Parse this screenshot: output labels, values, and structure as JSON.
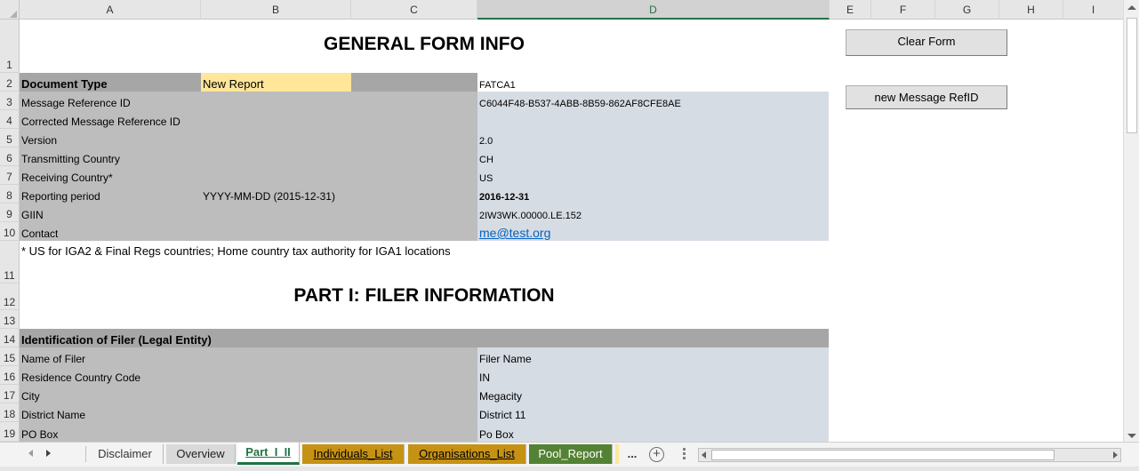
{
  "columns": [
    "A",
    "B",
    "C",
    "D",
    "E",
    "F",
    "G",
    "H",
    "I"
  ],
  "rows": [
    "1",
    "2",
    "3",
    "4",
    "5",
    "6",
    "7",
    "8",
    "9",
    "10",
    "11",
    "12",
    "13",
    "14",
    "15",
    "16",
    "17",
    "18",
    "19"
  ],
  "titles": {
    "general": "GENERAL FORM INFO",
    "part1": "PART I: FILER INFORMATION"
  },
  "buttons": {
    "clear_form": "Clear Form",
    "new_refid": "new Message RefID"
  },
  "general_info": {
    "document_type": {
      "label": "Document Type",
      "selector": "New Report",
      "value": "FATCA1"
    },
    "message_ref": {
      "label": "Message Reference ID",
      "value": "C6044F48-B537-4ABB-8B59-862AF8CFE8AE"
    },
    "corrected_ref": {
      "label": "Corrected Message Reference ID",
      "value": ""
    },
    "version": {
      "label": "Version",
      "value": "2.0"
    },
    "transmitting": {
      "label": "Transmitting Country",
      "value": "CH"
    },
    "receiving": {
      "label": "Receiving Country*",
      "value": "US"
    },
    "reporting": {
      "label": "Reporting period",
      "hint": "YYYY-MM-DD (2015-12-31)",
      "value": "2016-12-31"
    },
    "giin": {
      "label": "GIIN",
      "value": "2IW3WK.00000.LE.152"
    },
    "contact": {
      "label": "Contact",
      "value": "me@test.org"
    },
    "footnote": "* US for IGA2 & Final Regs countries; Home country tax authority for IGA1 locations"
  },
  "filer": {
    "section_header": "Identification of Filer (Legal Entity)",
    "name": {
      "label": "Name of Filer",
      "value": "Filer Name"
    },
    "residence": {
      "label": "Residence Country Code",
      "value": "IN"
    },
    "city": {
      "label": "City",
      "value": "Megacity"
    },
    "district": {
      "label": "District Name",
      "value": "District 11"
    },
    "pobox": {
      "label": "PO Box",
      "value": "Po Box"
    }
  },
  "tabs": [
    {
      "label": "Disclaimer"
    },
    {
      "label": "Overview"
    },
    {
      "label": "Part_I_II"
    },
    {
      "label": "Individuals_List"
    },
    {
      "label": "Organisations_List"
    },
    {
      "label": "Pool_Report"
    },
    {
      "label": "..."
    }
  ],
  "colors": {
    "label_grey": "#bdbdbd",
    "header_grey": "#a6a6a6",
    "value_blue": "#d6dce4",
    "selector_yellow": "#ffe699",
    "tab_gold": "#c69214",
    "tab_green": "#548235",
    "excel_green": "#217346"
  }
}
